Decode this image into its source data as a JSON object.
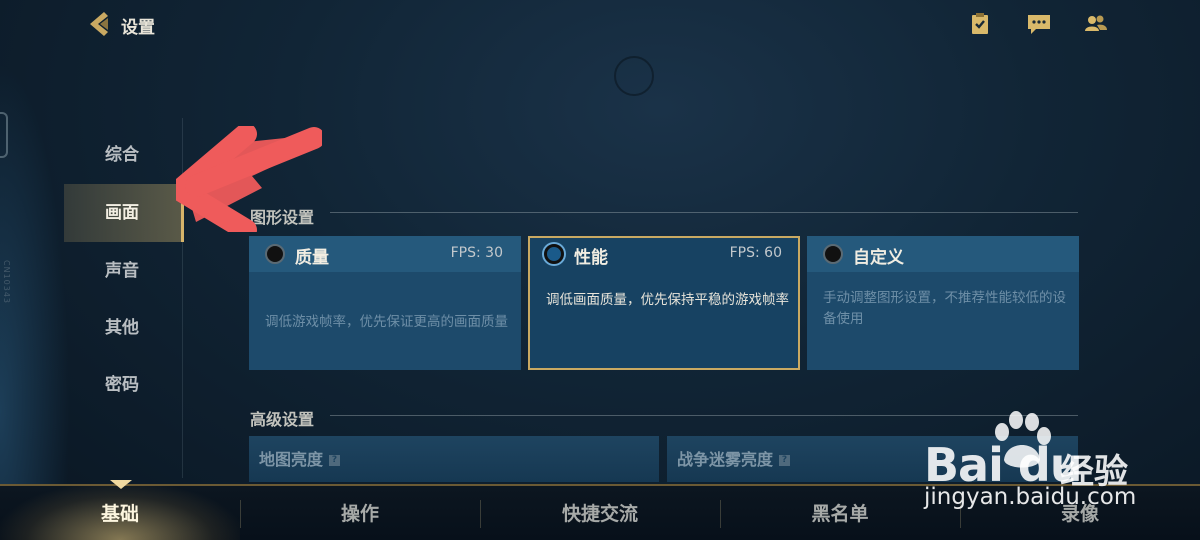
{
  "header": {
    "title": "设置",
    "icons": [
      "back-icon",
      "clipboard-check-icon",
      "chat-icon",
      "friends-icon"
    ]
  },
  "side_meta": "CN10343",
  "sidebar": {
    "items": [
      {
        "label": "综合",
        "active": false
      },
      {
        "label": "画面",
        "active": true
      },
      {
        "label": "声音",
        "active": false
      },
      {
        "label": "其他",
        "active": false
      },
      {
        "label": "密码",
        "active": false
      }
    ]
  },
  "graphics": {
    "section_title": "图形设置",
    "options": [
      {
        "name": "质量",
        "fps": "FPS: 30",
        "desc": "调低游戏帧率，优先保证更高的画面质量",
        "selected": false
      },
      {
        "name": "性能",
        "fps": "FPS: 60",
        "desc": "调低画面质量，优先保持平稳的游戏帧率",
        "selected": true
      },
      {
        "name": "自定义",
        "fps": "",
        "desc": "手动调整图形设置，不推荐性能较低的设备使用",
        "selected": false
      }
    ]
  },
  "advanced": {
    "section_title": "高级设置",
    "items": [
      {
        "label": "地图亮度",
        "help": "?"
      },
      {
        "label": "战争迷雾亮度",
        "help": "?"
      }
    ]
  },
  "tabs": [
    {
      "label": "基础",
      "active": true
    },
    {
      "label": "操作",
      "active": false
    },
    {
      "label": "快捷交流",
      "active": false
    },
    {
      "label": "黑名单",
      "active": false
    },
    {
      "label": "录像",
      "active": false
    }
  ],
  "watermark": {
    "brand": "Bai du",
    "brand_cn": "经验",
    "url": "jingyan.baidu.com"
  },
  "colors": {
    "accent_gold": "#d6b46a",
    "card_blue": "#1d4a6b",
    "annotation_red": "#ef5b5b"
  }
}
